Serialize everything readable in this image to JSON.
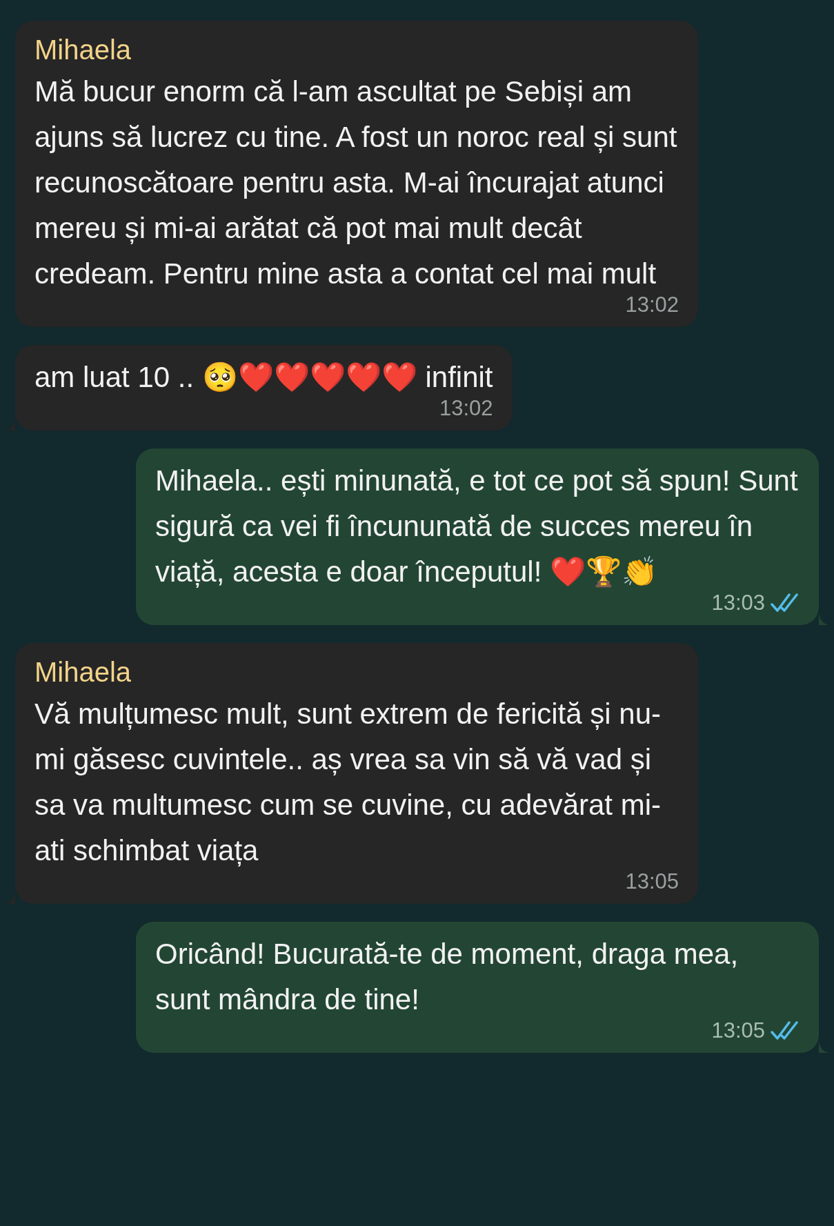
{
  "messages": [
    {
      "kind": "incoming",
      "sender": "Mihaela",
      "text": "Mă bucur enorm că l-am ascultat pe Sebiși am ajuns să lucrez cu tine. A fost un noroc real și sunt recunoscătoare pentru asta. M-ai încurajat atunci mereu și mi-ai arătat că pot mai mult decât credeam. Pentru mine asta a contat cel mai mult",
      "time": "13:02",
      "tail": false
    },
    {
      "kind": "incoming",
      "text": "am luat 10 .. 🥺❤️❤️❤️❤️❤️ infinit",
      "time": "13:02",
      "tail": true
    },
    {
      "kind": "outgoing",
      "text": "Mihaela.. ești minunată, e tot ce pot să spun! Sunt sigură ca vei fi încununată de succes mereu în viață, acesta e doar începutul! ❤️🏆👏",
      "time": "13:03",
      "read": true,
      "tail": true
    },
    {
      "kind": "incoming",
      "sender": "Mihaela",
      "text": "Vă mulțumesc mult, sunt extrem de fericită și nu-mi găsesc cuvintele.. aș vrea sa vin să vă vad și sa va multumesc cum se cuvine, cu adevărat mi-ati schimbat viața",
      "time": "13:05",
      "tail": true
    },
    {
      "kind": "outgoing",
      "text": "Oricând! Bucurată-te de moment, draga mea, sunt mândra de tine!",
      "time": "13:05",
      "read": true,
      "tail": true
    }
  ]
}
